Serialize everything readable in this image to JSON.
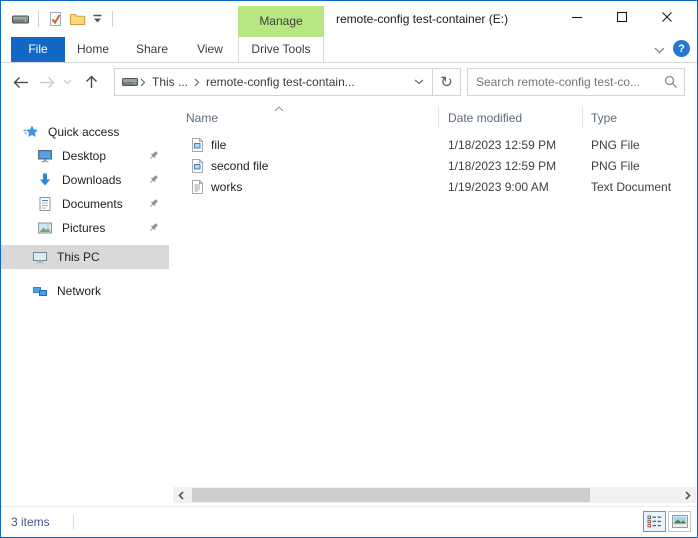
{
  "window": {
    "title": "remote-config test-container (E:)"
  },
  "titlebar": {
    "manage_label": "Manage",
    "help_label": "?"
  },
  "ribbon": {
    "file_tab": "File",
    "tabs": [
      "Home",
      "Share",
      "View"
    ],
    "contextual_tab": "Drive Tools"
  },
  "address": {
    "crumbs": [
      "This ...",
      "remote-config test-contain..."
    ],
    "search_placeholder": "Search remote-config test-co..."
  },
  "icons": {
    "refresh": "↻"
  },
  "sidebar": {
    "items": [
      {
        "label": "Quick access",
        "icon": "quick-access-star",
        "pinned": false,
        "selected": false
      },
      {
        "label": "Desktop",
        "icon": "desktop",
        "pinned": true,
        "selected": false
      },
      {
        "label": "Downloads",
        "icon": "downloads-arrow",
        "pinned": true,
        "selected": false
      },
      {
        "label": "Documents",
        "icon": "document",
        "pinned": true,
        "selected": false
      },
      {
        "label": "Pictures",
        "icon": "picture",
        "pinned": true,
        "selected": false
      },
      {
        "label": "This PC",
        "icon": "monitor",
        "pinned": false,
        "selected": true
      },
      {
        "label": "Network",
        "icon": "network",
        "pinned": false,
        "selected": false
      }
    ]
  },
  "file_list": {
    "columns": [
      "Name",
      "Date modified",
      "Type"
    ],
    "sort": {
      "column": "Name",
      "ascending": true
    },
    "rows": [
      {
        "name": "file",
        "date": "1/18/2023 12:59 PM",
        "type": "PNG File",
        "icon": "image-file"
      },
      {
        "name": "second file",
        "date": "1/18/2023 12:59 PM",
        "type": "PNG File",
        "icon": "image-file"
      },
      {
        "name": "works",
        "date": "1/19/2023 9:00 AM",
        "type": "Text Document",
        "icon": "text-file"
      }
    ]
  },
  "status_bar": {
    "items_count": "3 items"
  },
  "colors": {
    "accent_blue": "#1268c3",
    "manage_green": "#b7e683",
    "selection_gray": "#d9d9d9",
    "window_border": "#0d66c2",
    "status_text": "#44598c"
  }
}
